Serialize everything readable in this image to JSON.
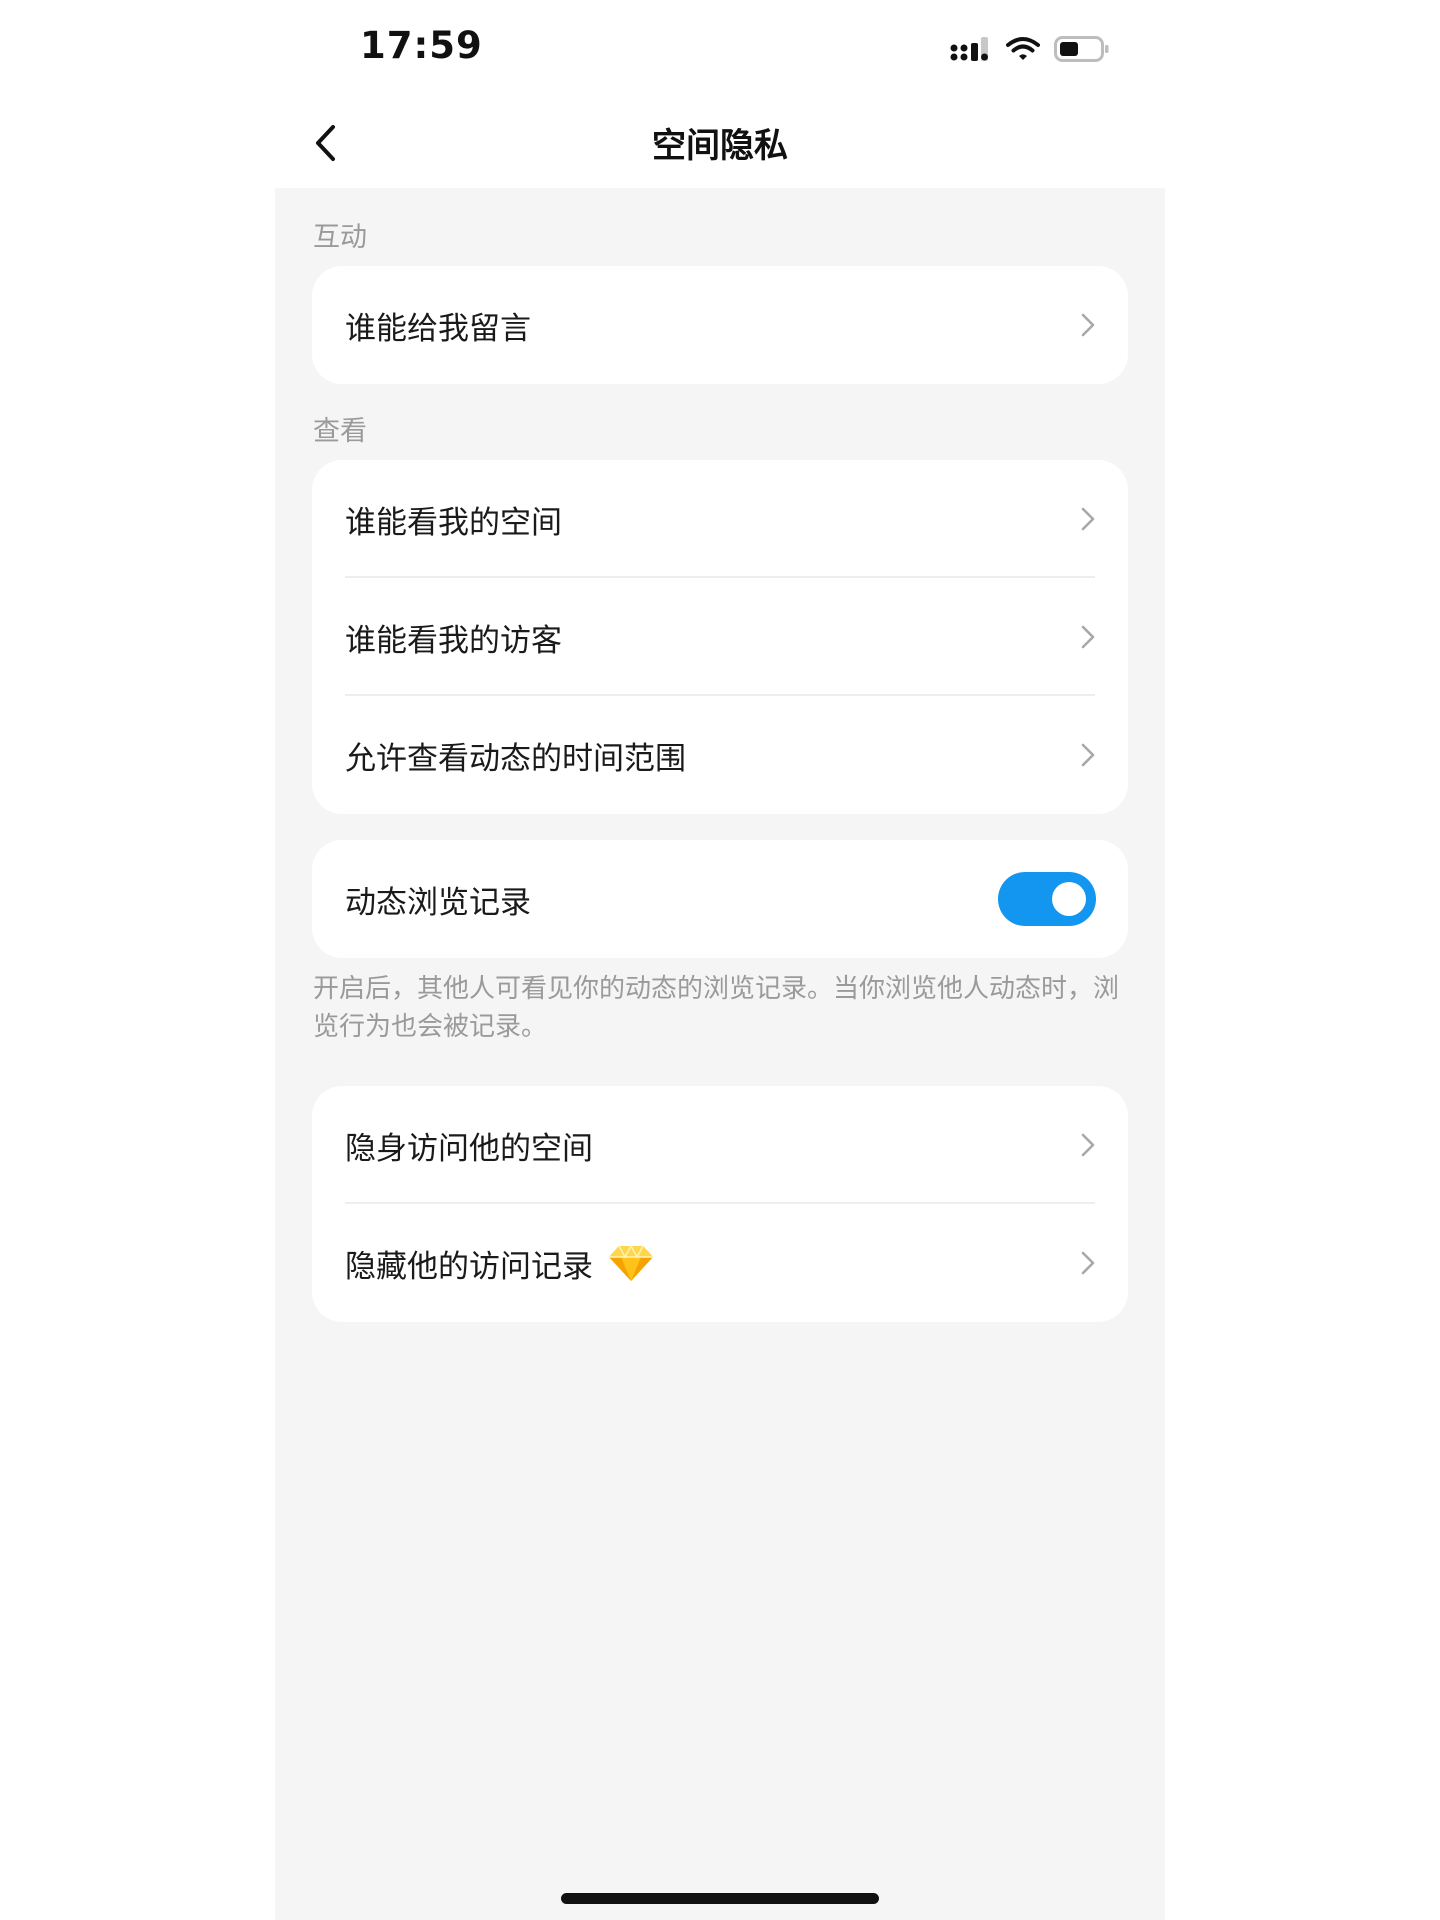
{
  "status_bar": {
    "time": "17:59"
  },
  "nav": {
    "title": "空间隐私"
  },
  "sections": {
    "interaction_label": "互动",
    "view_label": "查看"
  },
  "interaction_items": [
    {
      "label": "谁能给我留言"
    }
  ],
  "view_items": [
    {
      "label": "谁能看我的空间"
    },
    {
      "label": "谁能看我的访客"
    },
    {
      "label": "允许查看动态的时间范围"
    }
  ],
  "browse_record": {
    "label": "动态浏览记录",
    "enabled": true,
    "description": "开启后，其他人可看见你的动态的浏览记录。当你浏览他人动态时，浏览行为也会被记录。"
  },
  "stealth_items": [
    {
      "label": "隐身访问他的空间"
    },
    {
      "label": "隐藏他的访问记录",
      "badge_icon": "diamond-icon"
    }
  ],
  "colors": {
    "accent": "#1296ef",
    "background": "#f5f5f5",
    "card": "#ffffff",
    "muted_text": "#9a9a9a"
  }
}
